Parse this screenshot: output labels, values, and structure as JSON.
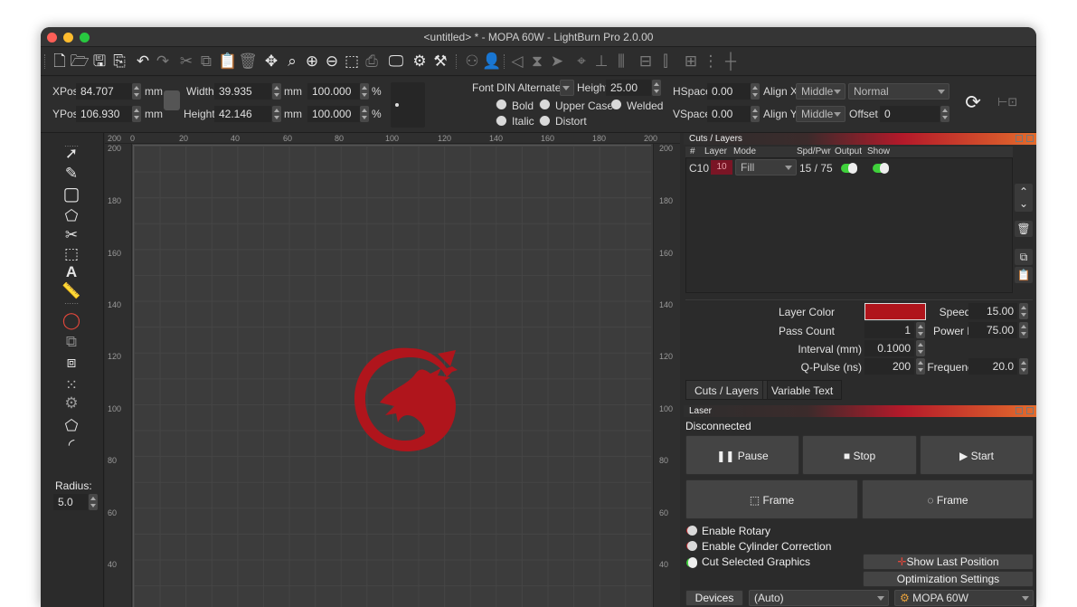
{
  "window": {
    "title": "<untitled> * - MOPA 60W - LightBurn Pro 2.0.00"
  },
  "toolbar": {
    "icons": [
      "new-file",
      "open-folder",
      "save",
      "export",
      "undo",
      "redo",
      "cut",
      "copy",
      "paste",
      "delete",
      "move",
      "zoom-to-page",
      "zoom-in",
      "zoom-out",
      "zoom-frame",
      "camera",
      "monitor",
      "settings",
      "tools",
      "group",
      "user",
      "mirror-h",
      "mirror-v",
      "send",
      "target",
      "align",
      "distribute",
      "rotate-center",
      "align-vertical",
      "layout",
      "grid"
    ]
  },
  "props": {
    "xpos_label": "XPos",
    "xpos_value": "84.707",
    "ypos_label": "YPos",
    "ypos_value": "106.930",
    "unit_mm": "mm",
    "width_label": "Width",
    "width_value": "39.935",
    "height_label": "Height",
    "height_value": "42.146",
    "scale_w": "100.000",
    "scale_h": "100.000",
    "percent": "%",
    "font_label": "Font",
    "font_value": "DIN Alternate",
    "font_height_label": "Height",
    "font_height_value": "25.00",
    "bold": "Bold",
    "upper_case": "Upper Case",
    "welded": "Welded",
    "italic": "Italic",
    "distort": "Distort",
    "hspace_label": "HSpace",
    "hspace_value": "0.00",
    "vspace_label": "VSpace",
    "vspace_value": "0.00",
    "alignx_label": "Align X",
    "alignx_value": "Middle",
    "aligny_label": "Align Y",
    "aligny_value": "Middle",
    "mode_value": "Normal",
    "offset_label": "Offset",
    "offset_value": "0"
  },
  "left_tools": {
    "radius_label": "Radius:",
    "radius_value": "5.0"
  },
  "canvas": {
    "top_ticks": [
      "200",
      "0",
      "20",
      "40",
      "60",
      "80",
      "100",
      "120",
      "140",
      "160",
      "180",
      "200"
    ],
    "side_ticks": [
      "200",
      "180",
      "160",
      "140",
      "120",
      "100",
      "80",
      "60",
      "40"
    ]
  },
  "cuts": {
    "panel_title": "Cuts / Layers",
    "headers": {
      "num": "#",
      "layer": "Layer",
      "mode": "Mode",
      "spdpwr": "Spd/Pwr",
      "output": "Output",
      "show": "Show"
    },
    "row": {
      "num": "C10",
      "layer": "10",
      "mode": "Fill",
      "spdpwr": "15 / 75",
      "layer_color": "#b0151c"
    },
    "layer_color_label": "Layer Color",
    "pass_count_label": "Pass Count",
    "pass_count_value": "1",
    "interval_label": "Interval (mm)",
    "interval_value": "0.1000",
    "qpulse_label": "Q-Pulse (ns)",
    "qpulse_value": "200",
    "speed_label": "Speed (mm/s)",
    "speed_value": "15.00",
    "power_label": "Power Max (%)",
    "power_value": "75.00",
    "frequency_label": "Frequency (kHz)",
    "frequency_value": "20.0",
    "tabs": [
      "Cuts / Layers",
      "Variable Text"
    ]
  },
  "laser": {
    "panel_title": "Laser",
    "status": "Disconnected",
    "pause": "Pause",
    "stop": "Stop",
    "start": "Start",
    "frame1": "Frame",
    "frame2": "Frame",
    "enable_rotary": "Enable Rotary",
    "enable_cylinder": "Enable Cylinder Correction",
    "cut_selected": "Cut Selected Graphics",
    "show_last_position": "Show Last Position",
    "optimization_settings": "Optimization Settings",
    "devices": "Devices",
    "port_value": "(Auto)",
    "device_value": "MOPA 60W"
  },
  "colors": {
    "accent_red": "#b0151c",
    "toggle_green": "#3fd13b",
    "toggle_red": "#c8282e"
  }
}
